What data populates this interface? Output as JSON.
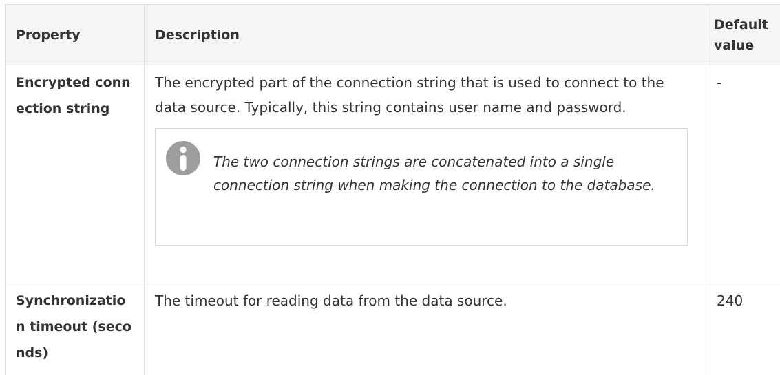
{
  "table": {
    "headers": {
      "property": "Property",
      "description": "Description",
      "default_value": "Default value"
    },
    "rows": [
      {
        "property": "Encrypted connection string",
        "description": "The encrypted part of the connection string that is used to connect to the data source. Typically, this string contains user name and password.",
        "note": {
          "icon": "info-icon",
          "text": "The two connection strings are concatenated into a single connection string when making the connection to the database."
        },
        "default_value": "-"
      },
      {
        "property": "Synchronization timeout (seconds)",
        "description": "The timeout for reading data from the data source.",
        "default_value": "240"
      }
    ]
  },
  "colors": {
    "header_background": "#f5f5f5",
    "border": "#dddddd",
    "note_border": "#d9d9d9",
    "icon_fill": "#9e9e9e",
    "text": "#333333"
  }
}
